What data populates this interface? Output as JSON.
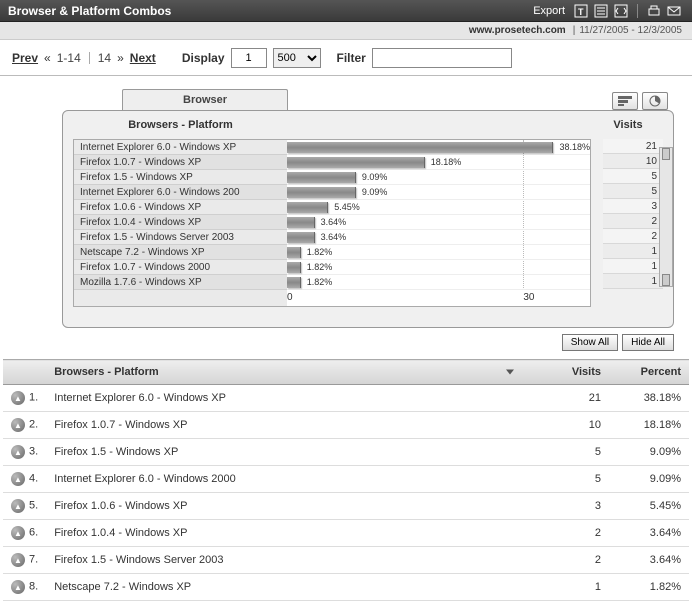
{
  "header": {
    "title": "Browser & Platform Combos",
    "export_label": "Export"
  },
  "info": {
    "site": "www.prosetech.com",
    "date_range": "11/27/2005 - 12/3/2005"
  },
  "nav": {
    "prev_label": "Prev",
    "range_text": "1-14",
    "total_text": "14",
    "next_label": "Next",
    "display_label": "Display",
    "page_value": "1",
    "page_size": "500",
    "filter_label": "Filter",
    "filter_value": ""
  },
  "chart": {
    "tab_label": "Browser",
    "left_header": "Browsers - Platform",
    "right_header": "Visits",
    "x_min": "0",
    "x_max": "30"
  },
  "chart_data": {
    "type": "bar",
    "title": "Browsers - Platform",
    "xlabel": "",
    "ylabel": "Visits",
    "ylim": [
      0,
      40
    ],
    "categories": [
      "Internet Explorer 6.0 - Windows XP",
      "Firefox 1.0.7 - Windows XP",
      "Firefox 1.5 - Windows XP",
      "Internet Explorer 6.0 - Windows 2000",
      "Firefox 1.0.6 - Windows XP",
      "Firefox 1.0.4 - Windows XP",
      "Firefox 1.5 - Windows Server 2003",
      "Netscape 7.2 - Windows XP",
      "Firefox 1.0.7 - Windows 2000",
      "Mozilla 1.7.6 - Windows XP"
    ],
    "series": [
      {
        "name": "Percent",
        "values": [
          38.18,
          18.18,
          9.09,
          9.09,
          5.45,
          3.64,
          3.64,
          1.82,
          1.82,
          1.82
        ]
      },
      {
        "name": "Visits",
        "values": [
          21,
          10,
          5,
          5,
          3,
          2,
          2,
          1,
          1,
          1
        ]
      }
    ],
    "bar_labels": [
      "38.18%",
      "18.18%",
      "9.09%",
      "9.09%",
      "5.45%",
      "3.64%",
      "3.64%",
      "1.82%",
      "1.82%",
      "1.82%"
    ]
  },
  "buttons": {
    "show_all": "Show All",
    "hide_all": "Hide All"
  },
  "table": {
    "headers": {
      "name": "Browsers - Platform",
      "visits": "Visits",
      "percent": "Percent"
    },
    "rows": [
      {
        "rank": "1.",
        "name": "Internet Explorer 6.0 - Windows XP",
        "visits": "21",
        "percent": "38.18%"
      },
      {
        "rank": "2.",
        "name": "Firefox 1.0.7 - Windows XP",
        "visits": "10",
        "percent": "18.18%"
      },
      {
        "rank": "3.",
        "name": "Firefox 1.5 - Windows XP",
        "visits": "5",
        "percent": "9.09%"
      },
      {
        "rank": "4.",
        "name": "Internet Explorer 6.0 - Windows 2000",
        "visits": "5",
        "percent": "9.09%"
      },
      {
        "rank": "5.",
        "name": "Firefox 1.0.6 - Windows XP",
        "visits": "3",
        "percent": "5.45%"
      },
      {
        "rank": "6.",
        "name": "Firefox 1.0.4 - Windows XP",
        "visits": "2",
        "percent": "3.64%"
      },
      {
        "rank": "7.",
        "name": "Firefox 1.5 - Windows Server 2003",
        "visits": "2",
        "percent": "3.64%"
      },
      {
        "rank": "8.",
        "name": "Netscape 7.2 - Windows XP",
        "visits": "1",
        "percent": "1.82%"
      }
    ]
  }
}
